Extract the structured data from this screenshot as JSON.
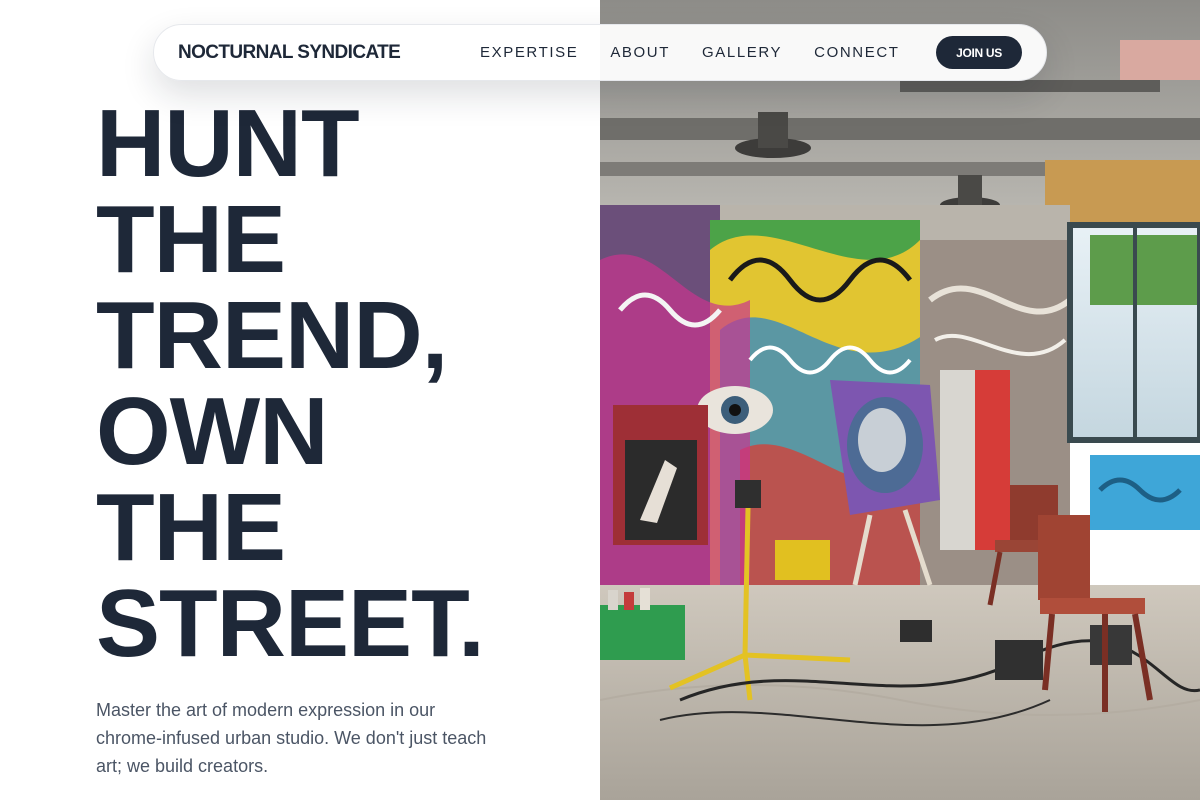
{
  "nav": {
    "brand": "NOCTURNAL SYNDICATE",
    "links": [
      "EXPERTISE",
      "ABOUT",
      "GALLERY",
      "CONNECT"
    ],
    "cta_label": "JOIN US"
  },
  "hero": {
    "headline_lines": [
      "HUNT",
      "THE",
      "TREND,",
      "OWN",
      "THE",
      "STREET."
    ],
    "subtext": "Master the art of modern expression in our chrome-infused urban studio. We don't just teach art; we build creators."
  },
  "colors": {
    "ink": "#1e2838",
    "muted_text": "#4b5565",
    "background": "#ffffff"
  }
}
